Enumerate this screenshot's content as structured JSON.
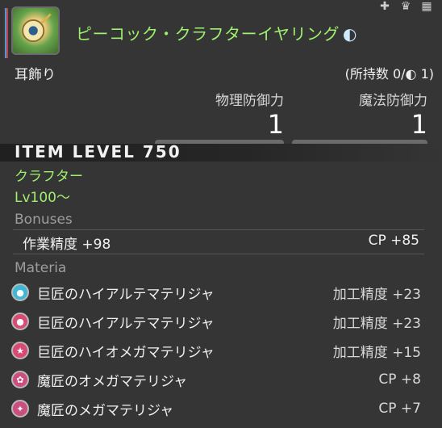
{
  "header": {
    "item_name": "ピーコック・クラフターイヤリング",
    "hq_symbol": "◐",
    "category": "耳飾り",
    "owned": "(所持数 0/◐ 1)"
  },
  "top_icons": [
    "plus-icon",
    "trash-icon",
    "compare-icon"
  ],
  "stats": [
    {
      "label": "物理防御力",
      "value": "1"
    },
    {
      "label": "魔法防御力",
      "value": "1"
    }
  ],
  "item_level": "ITEM LEVEL 750",
  "class": "クラフター",
  "level": "Lv100～",
  "bonuses": {
    "title": "Bonuses",
    "left": "作業精度 +98",
    "right": "CP +85"
  },
  "materia": {
    "title": "Materia",
    "items": [
      {
        "name": "巨匠のハイアルテマテリジャ",
        "bonus": "加工精度 +23",
        "color": "#3eb7d6"
      },
      {
        "name": "巨匠のハイアルテマテリジャ",
        "bonus": "加工精度 +23",
        "color": "#d94a72"
      },
      {
        "name": "巨匠のハイオメガマテリジャ",
        "bonus": "加工精度 +15",
        "color": "#d94a72"
      },
      {
        "name": "魔匠のオメガマテリジャ",
        "bonus": "CP +8",
        "color": "#c94f7e"
      },
      {
        "name": "魔匠のメガマテリジャ",
        "bonus": "CP +7",
        "color": "#c94f7e"
      }
    ]
  }
}
